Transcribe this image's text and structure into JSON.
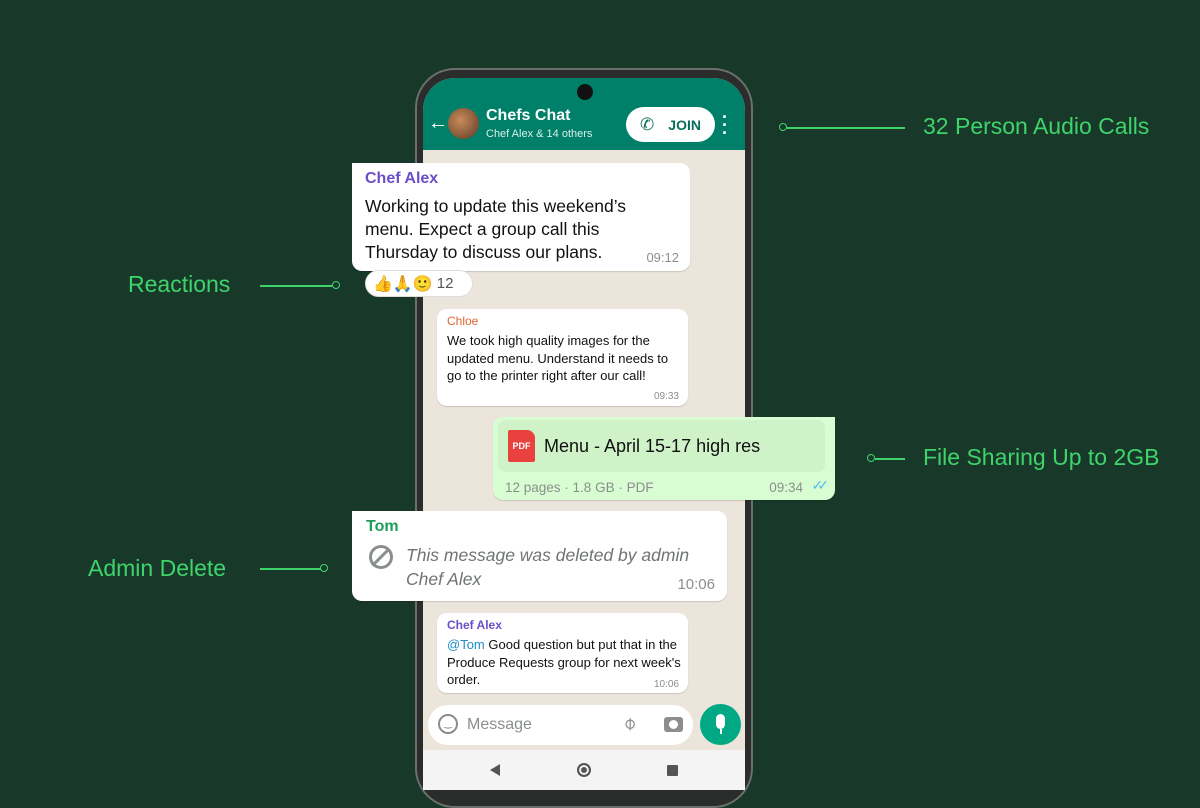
{
  "annotations": {
    "audio": "32 Person Audio Calls",
    "reactions": "Reactions",
    "file": "File Sharing Up to 2GB",
    "admin": "Admin Delete"
  },
  "header": {
    "title": "Chefs Chat",
    "subtitle": "Chef Alex & 14 others",
    "join": "JOIN"
  },
  "messages": [
    {
      "sender": "Chef Alex",
      "text": "Working to update this weekend’s menu. Expect a group call this Thursday to discuss our plans.",
      "time": "09:12",
      "reactions": "👍🙏🙂",
      "reaction_count": "12"
    },
    {
      "sender": "Chloe",
      "text": "We took high quality images for the updated menu. Understand it needs to go to the printer right after our call!",
      "time": "09:33"
    },
    {
      "file_icon": "PDF",
      "file_name": "Menu - April 15-17 high res",
      "file_meta": "12 pages · 1.8 GB · PDF",
      "time": "09:34"
    },
    {
      "sender": "Tom",
      "text": "This message was deleted by admin Chef Alex",
      "time": "10:06"
    },
    {
      "sender": "Chef Alex",
      "mention": "@Tom",
      "text": " Good question but put that in the Produce Requests group for next week's order.",
      "time": "10:06"
    }
  ],
  "input": {
    "placeholder": "Message"
  },
  "colors": {
    "accent": "#3fd46b",
    "header": "#008069",
    "outgoing": "#d9fdd3",
    "mic": "#00a884"
  }
}
